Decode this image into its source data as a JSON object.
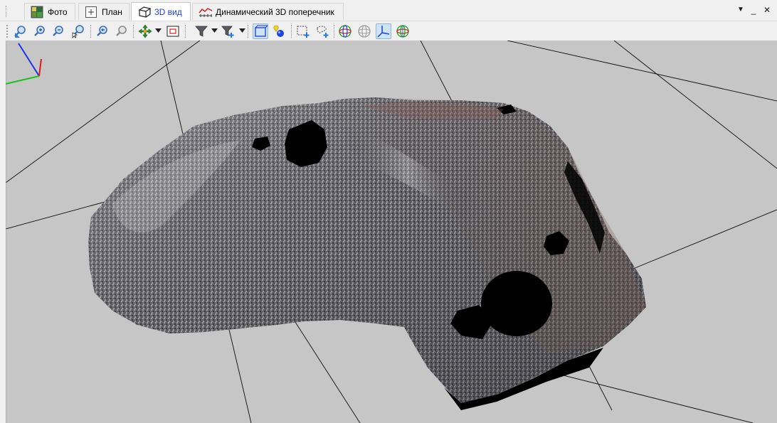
{
  "tabs": [
    {
      "label": "Фото",
      "icon": "photo-icon",
      "active": false
    },
    {
      "label": "План",
      "icon": "plan-icon",
      "active": false
    },
    {
      "label": "3D вид",
      "icon": "cube-3d-icon",
      "active": true
    },
    {
      "label": "Динамический 3D поперечник",
      "icon": "cross-section-icon",
      "active": false
    }
  ],
  "window_buttons": {
    "menu": "▼",
    "minimize": "_",
    "close": "✕"
  },
  "toolbar": {
    "buttons": [
      {
        "name": "zoom-extents-icon"
      },
      {
        "name": "zoom-in-icon"
      },
      {
        "name": "zoom-out-icon"
      },
      {
        "name": "zoom-window-icon"
      },
      {
        "name": "zoom-previous-icon"
      },
      {
        "name": "zoom-next-icon"
      },
      {
        "name": "pan-navigation-icon"
      },
      {
        "name": "view-frame-icon"
      },
      {
        "name": "filter-icon"
      },
      {
        "name": "filter-add-icon"
      },
      {
        "name": "bounding-box-icon",
        "pressed": true
      },
      {
        "name": "point-light-icon"
      },
      {
        "name": "rect-select-add-icon"
      },
      {
        "name": "lasso-select-add-icon"
      },
      {
        "name": "sphere-color-icon"
      },
      {
        "name": "sphere-grey-icon"
      },
      {
        "name": "axes-icon",
        "pressed": true
      },
      {
        "name": "sphere-green-icon"
      }
    ]
  },
  "colors": {
    "viewport_bg": "#c6c6c6",
    "grid_line": "#1e1e1e",
    "axis_x": "#e01818",
    "axis_y": "#19c219",
    "axis_z": "#1a33e6",
    "active_tab_text": "#1a3cd6",
    "rock_dark": "#3c3c40",
    "rock_mid": "#7a7a80",
    "rock_light": "#b9b8bc"
  }
}
